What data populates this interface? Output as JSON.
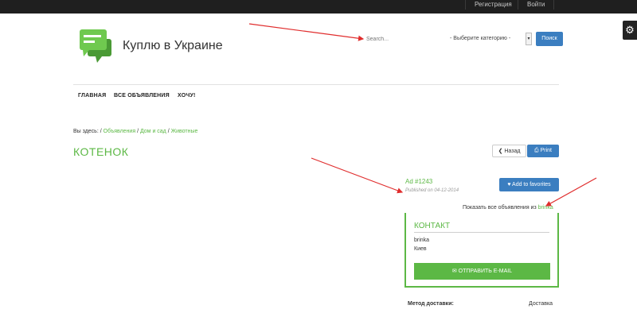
{
  "topbar": {
    "register": "Регистрация",
    "login": "Войти"
  },
  "header": {
    "site_title": "Куплю в Украине",
    "search_placeholder": "Search...",
    "category_select": "- Выберите категорию -",
    "search_button": "Поиск"
  },
  "nav": {
    "items": [
      "ГЛАВНАЯ",
      "ВСЕ ОБЪЯВЛЕНИЯ",
      "ХОЧУ!"
    ]
  },
  "breadcrumb": {
    "label": "Вы здесь:",
    "items": [
      "Объявления",
      "Дом и сад",
      "Животные"
    ]
  },
  "page": {
    "title": "КОТЕНОК",
    "back_label": "Назад",
    "print_label": "Print"
  },
  "ad": {
    "number": "Ad #1243",
    "date": "Published on 04-12-2014",
    "favorites_label": "Add to favorites",
    "all_ads_text": "Показать все объявления из",
    "user_link": "brinka"
  },
  "contact": {
    "title": "КОНТАКТ",
    "user": "brinka",
    "city": "Киев",
    "email_button": "ОТПРАВИТЬ E-MAIL"
  },
  "details": {
    "delivery_label": "Метод доставки:",
    "delivery_value": "Доставка"
  },
  "colors": {
    "accent_green": "#5cb845",
    "button_blue": "#3b7ec0",
    "topbar": "#1f1f1f",
    "annotation_arrow": "#e02d2d"
  },
  "icons": [
    "gear-icon",
    "chat-bubble-logo-icon",
    "chevron-left-icon",
    "print-icon",
    "heart-icon",
    "envelope-icon"
  ]
}
